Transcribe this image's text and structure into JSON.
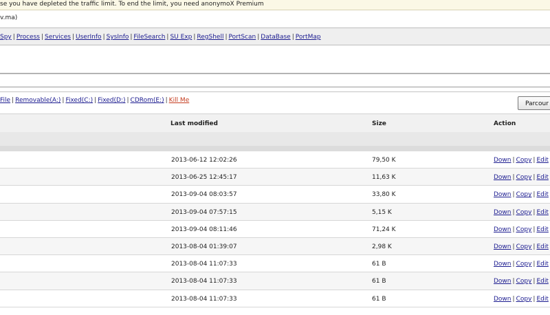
{
  "notice": "se you have depleted the traffic limit. To end the limit, you need anonymoX Premium",
  "host": "v.ma)",
  "nav": {
    "items": [
      "Spy",
      "Process",
      "Services",
      "UserInfo",
      "SysInfo",
      "FileSearch",
      "SU Exp",
      "RegShell",
      "PortScan",
      "DataBase",
      "PortMap"
    ]
  },
  "drives": {
    "items": [
      "File",
      "Removable(A:)",
      "Fixed(C:)",
      "Fixed(D:)",
      "CDRom(E:)"
    ],
    "kill": "Kill Me",
    "browse_button": "Parcour"
  },
  "table": {
    "headers": {
      "modified": "Last modified",
      "size": "Size",
      "action": "Action"
    },
    "actions": {
      "down": "Down",
      "copy": "Copy",
      "edit": "Edit"
    },
    "rows": [
      {
        "modified": "2013-06-12 12:02:26",
        "size": "79,50 K"
      },
      {
        "modified": "2013-06-25 12:45:17",
        "size": "11,63 K"
      },
      {
        "modified": "2013-09-04 08:03:57",
        "size": "33,80 K"
      },
      {
        "modified": "2013-09-04 07:57:15",
        "size": "5,15 K"
      },
      {
        "modified": "2013-09-04 08:11:46",
        "size": "71,24 K"
      },
      {
        "modified": "2013-08-04 01:39:07",
        "size": "2,98 K"
      },
      {
        "modified": "2013-08-04 11:07:33",
        "size": "61 B"
      },
      {
        "modified": "2013-08-04 11:07:33",
        "size": "61 B"
      },
      {
        "modified": "2013-08-04 11:07:33",
        "size": "61 B"
      }
    ]
  }
}
